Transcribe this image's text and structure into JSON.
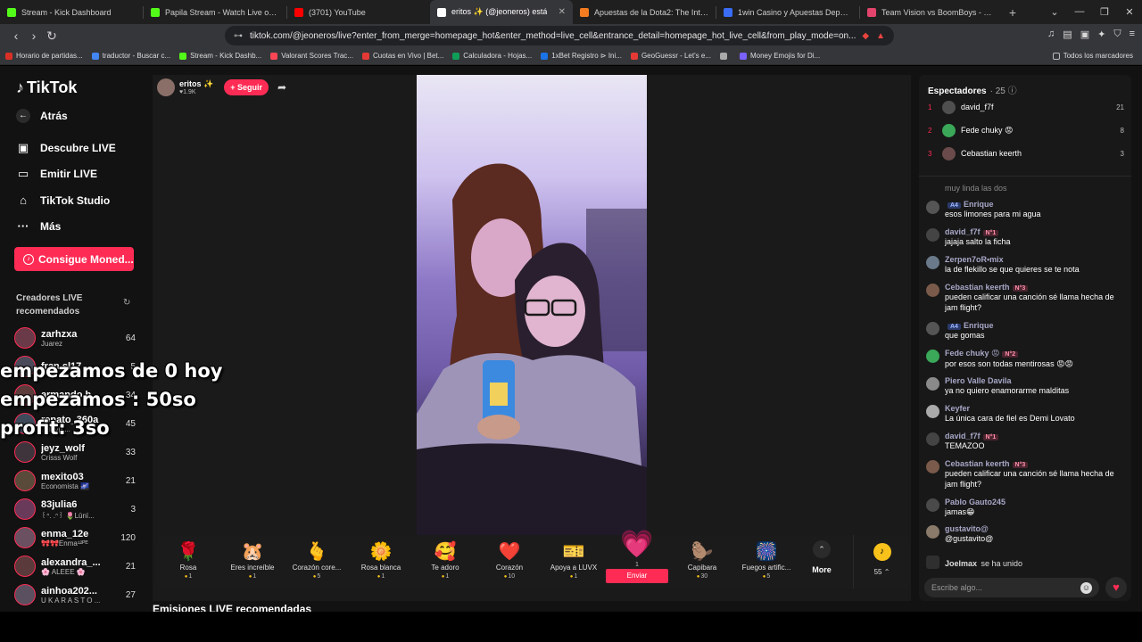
{
  "browser": {
    "tabs": [
      {
        "title": "Stream - Kick Dashboard",
        "color": "#53fc18",
        "active": false
      },
      {
        "title": "Papila Stream - Watch Live on K",
        "color": "#53fc18",
        "active": false
      },
      {
        "title": "(3701) YouTube",
        "color": "#ff0000",
        "active": false
      },
      {
        "title": "eritos ✨ (@jeoneros) está",
        "color": "#ffffff",
        "active": true
      },
      {
        "title": "Apuestas de la Dota2: The Internatio",
        "color": "#f47c20",
        "active": false
      },
      {
        "title": "1win Casino y Apuestas Deportivas",
        "color": "#3a6cf4",
        "active": false
      },
      {
        "title": "Team Vision vs BoomBoys - 20/08/2",
        "color": "#e2446b",
        "active": false
      }
    ],
    "new_tab": "+",
    "url": "tiktok.com/@jeoneros/live?enter_from_merge=homepage_hot&enter_method=live_cell&entrance_detail=homepage_hot_live_cell&from_play_mode=on...",
    "bookmarks": [
      {
        "label": "Horario de partidas...",
        "color": "#d93025"
      },
      {
        "label": "traductor - Buscar c...",
        "color": "#4285f4"
      },
      {
        "label": "Stream - Kick Dashb...",
        "color": "#53fc18"
      },
      {
        "label": "Valorant Scores Trac...",
        "color": "#ff4655"
      },
      {
        "label": "Cuotas en Vivo | Bet...",
        "color": "#e53935"
      },
      {
        "label": "Calculadora - Hojas...",
        "color": "#0f9d58"
      },
      {
        "label": "1xBet Registro ⊳ Ini...",
        "color": "#1a73e8"
      },
      {
        "label": "GeoGuessr - Let's e...",
        "color": "#e53935"
      },
      {
        "label": "",
        "color": "#aaaaaa"
      },
      {
        "label": "Money Emojis for Di...",
        "color": "#7b61ff"
      }
    ],
    "bookmarks_all": "Todos los marcadores"
  },
  "sidebar": {
    "logo": "TikTok",
    "back": "Atrás",
    "links": [
      "Descubre LIVE",
      "Emitir LIVE",
      "TikTok Studio",
      "Más"
    ],
    "coins_button": "Consigue Moned...",
    "recommended_title": "Creadores LIVE recomendados",
    "creators": [
      {
        "name": "zarhzxa",
        "sub": "Juarez",
        "count": "64"
      },
      {
        "name": "fran.sl17",
        "sub": "",
        "count": "5"
      },
      {
        "name": "armando.h...",
        "sub": "",
        "count": "34"
      },
      {
        "name": "renato_360a",
        "sub": "... Mvp ...",
        "count": "45"
      },
      {
        "name": "jeyz_wolf",
        "sub": "Crisss Wolf",
        "count": "33"
      },
      {
        "name": "mexito03",
        "sub": "Economista 🌌",
        "count": "21"
      },
      {
        "name": "83julia6",
        "sub": "꒰ᐢ. .ᐢ꒱ 🌷Lūnï...",
        "count": "3"
      },
      {
        "name": "enma_12e",
        "sub": "🎀🎀Enma¹²ᴾᴱ",
        "count": "120"
      },
      {
        "name": "alexandra_...",
        "sub": "🌸 ALEEE 🌸",
        "count": "21"
      },
      {
        "name": "ainhoa202...",
        "sub": "U K A R A S T O ...",
        "count": "27"
      }
    ]
  },
  "overlay": {
    "line1": "empezamos de 0 hoy",
    "line2": "empezamos : 50so",
    "line3": "profit:  3so"
  },
  "stream": {
    "host_name": "eritos ✨",
    "host_likes": "♥1.9K",
    "follow_label": "+ Seguir"
  },
  "gifts": [
    {
      "name": "Rosa",
      "price": "1",
      "icon": "🌹"
    },
    {
      "name": "Eres increíble",
      "price": "1",
      "icon": "🐹"
    },
    {
      "name": "Corazón core...",
      "price": "5",
      "icon": "🫰"
    },
    {
      "name": "Rosa blanca",
      "price": "1",
      "icon": "🌼"
    },
    {
      "name": "Te adoro",
      "price": "1",
      "icon": "🥰"
    },
    {
      "name": "Corazón",
      "price": "10",
      "icon": "❤️"
    },
    {
      "name": "Apoya a LUVX",
      "price": "1",
      "icon": "🎫"
    },
    {
      "name": "Capibara",
      "price": "30",
      "icon": "🦫"
    },
    {
      "name": "Fuegos artific...",
      "price": "5",
      "icon": "🎆"
    }
  ],
  "gift_featured": {
    "price": "1",
    "send_label": "Enviar",
    "icon": "💗"
  },
  "gift_more": {
    "label": "More",
    "icon": "⌃"
  },
  "coin_balance": "55 ⌃",
  "recommended_streams_title": "Emisiones LIVE recomendadas",
  "chat": {
    "viewers_title": "Espectadores",
    "viewers_count": "· 25 ⓘ",
    "top_viewers": [
      {
        "rank": "1",
        "name": "david_f7f",
        "score": "21"
      },
      {
        "rank": "2",
        "name": "Fede chuky 😡",
        "score": "8"
      },
      {
        "rank": "3",
        "name": "Cebastian keerth",
        "score": "3"
      }
    ],
    "partial_text": "muy linda las dos",
    "messages": [
      {
        "user": "Enrique",
        "badge": "A4",
        "text": "esos limones para mi agua"
      },
      {
        "user": "david_f7f",
        "badge": "N°1",
        "text": "jajaja salto la ficha"
      },
      {
        "user": "Zerpen7oR•mix",
        "badge": "",
        "text": "la de flekillo se que quieres se te nota"
      },
      {
        "user": "Cebastian keerth",
        "badge": "N°3",
        "text": "pueden calificar una canción sé llama hecha de jam flight?"
      },
      {
        "user": "Enrique",
        "badge": "A4",
        "text": "que gomas"
      },
      {
        "user": "Fede chuky 😡",
        "badge": "N°2",
        "text": "por esos son todas mentirosas 😡😡"
      },
      {
        "user": "Piero Valle Davila",
        "badge": "",
        "text": "ya no quiero enamorarme malditas"
      },
      {
        "user": "Keyfer",
        "badge": "",
        "text": "La única cara de fiel es Demi Lovato"
      },
      {
        "user": "david_f7f",
        "badge": "N°1",
        "text": "TEMAZOO"
      },
      {
        "user": "Cebastian keerth",
        "badge": "N°3",
        "text": "pueden calificar una canción sé llama hecha de jam flight?"
      },
      {
        "user": "Pablo Gauto245",
        "badge": "",
        "text": "jamas😁"
      },
      {
        "user": "gustavito@",
        "badge": "",
        "text": "@gustavito@"
      }
    ],
    "join_user": "Joelmax",
    "join_text": "se ha unido",
    "input_placeholder": "Escribe algo..."
  }
}
